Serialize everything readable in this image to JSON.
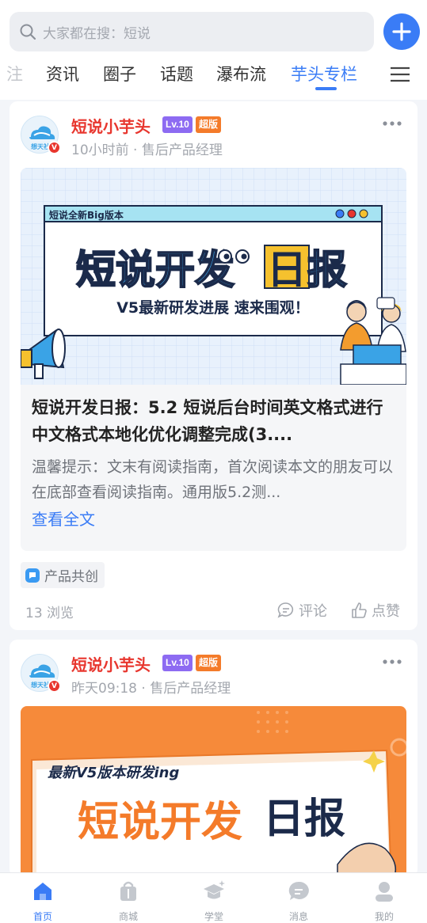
{
  "search": {
    "placeholder": "大家都在搜：短说"
  },
  "tabs": [
    {
      "label": "注",
      "state": "partial"
    },
    {
      "label": "资讯"
    },
    {
      "label": "圈子"
    },
    {
      "label": "话题"
    },
    {
      "label": "瀑布流"
    },
    {
      "label": "芋头专栏",
      "active": true
    }
  ],
  "posts": [
    {
      "author": "短说小芋头",
      "level_badge": "Lv.10",
      "vip_badge": "超版",
      "verified_mark": "V",
      "avatar_text": "想天社",
      "meta": "10小时前 · 售后产品经理",
      "cover": {
        "window_title": "短说全新Big版本",
        "headline_a": "短说开发",
        "headline_b": "日",
        "headline_c": "报",
        "subline": "V5最新研发进展 速来围观！"
      },
      "title": "短说开发日报：5.2 短说后台时间英文格式进行中文格式本地化优化调整完成(3....",
      "excerpt": "温馨提示：文末有阅读指南，首次阅读本文的朋友可以在底部查看阅读指南。通用版5.2测...",
      "read_more": "查看全文",
      "topic": "产品共创",
      "views": "13 浏览",
      "comment_label": "评论",
      "like_label": "点赞"
    },
    {
      "author": "短说小芋头",
      "level_badge": "Lv.10",
      "vip_badge": "超版",
      "verified_mark": "V",
      "avatar_text": "想天社",
      "meta": "昨天09:18 · 售后产品经理",
      "cover": {
        "tagline": "最新V5版本研发ing",
        "headline_a": "短说开发",
        "headline_b": "日报"
      }
    }
  ],
  "bottom_nav": [
    {
      "label": "首页",
      "icon": "home-icon",
      "active": true
    },
    {
      "label": "商城",
      "icon": "shop-bag-icon"
    },
    {
      "label": "学堂",
      "icon": "graduation-cap-icon"
    },
    {
      "label": "消息",
      "icon": "message-icon"
    },
    {
      "label": "我的",
      "icon": "user-icon"
    }
  ],
  "colors": {
    "accent": "#3a7cf6",
    "author_red": "#e8362e",
    "level_purple": "#8d6bf2",
    "vip_orange": "#f47b2a",
    "cover_orange": "#f68a3a"
  }
}
